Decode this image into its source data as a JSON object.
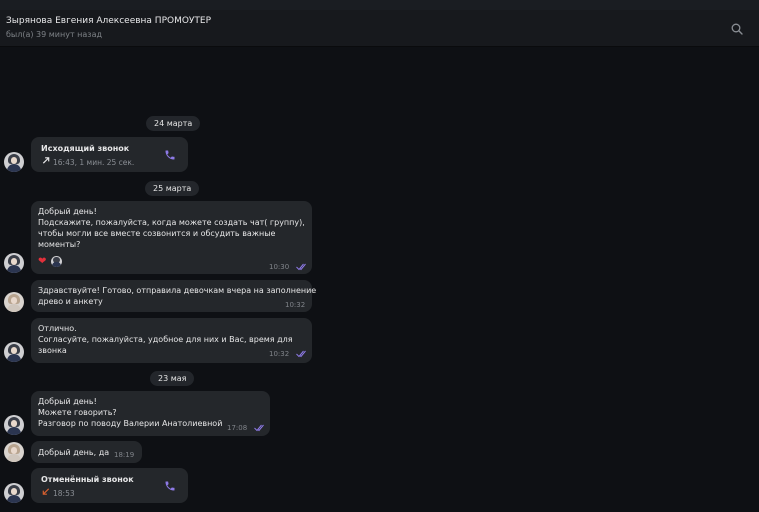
{
  "header": {
    "title": "Зырянова Евгения Алексеевна ПРОМОУТЕР",
    "status": "был(а) 39 минут назад",
    "search_icon": "search-icon"
  },
  "colors": {
    "background": "#0e1014",
    "bubble": "#24272b",
    "accent": "#8e7ae6",
    "outgoing_arrow": "#e9e9ea",
    "missed_arrow": "#d9602f",
    "heart": "#e2303b"
  },
  "days": [
    "24 марта",
    "25 марта",
    "23 мая"
  ],
  "messages": [
    {
      "type": "call",
      "title": "Исходящий звонок",
      "direction": "outgoing",
      "detail": "16:43, 1 мин. 25 сек."
    },
    {
      "type": "text",
      "text": "Добрый день!\nПодскажите, пожалуйста, когда можете создать чат( группу),\nчтобы могли все вместе созвонится и обсудить важные\nмоменты?",
      "time": "10:30",
      "read": true,
      "reaction": "❤"
    },
    {
      "type": "text",
      "text": "Здравствуйте! Готово, отправила девочкам вчера на заполнение\nдрево и анкету",
      "time": "10:32",
      "read": false
    },
    {
      "type": "text",
      "text": "Отлично.\nСогласуйте, пожалуйста, удобное для них и Вас, время для\nзвонка",
      "time": "10:32",
      "read": true
    },
    {
      "type": "text",
      "text": "Добрый день!\nМожете говорить?\nРазговор по поводу Валерии Анатолиевной",
      "time": "17:08",
      "read": true
    },
    {
      "type": "text",
      "text": "Добрый день, да",
      "time": "18:19",
      "read": false
    },
    {
      "type": "call",
      "title": "Отменённый звонок",
      "direction": "missed",
      "detail": "18:53"
    }
  ]
}
